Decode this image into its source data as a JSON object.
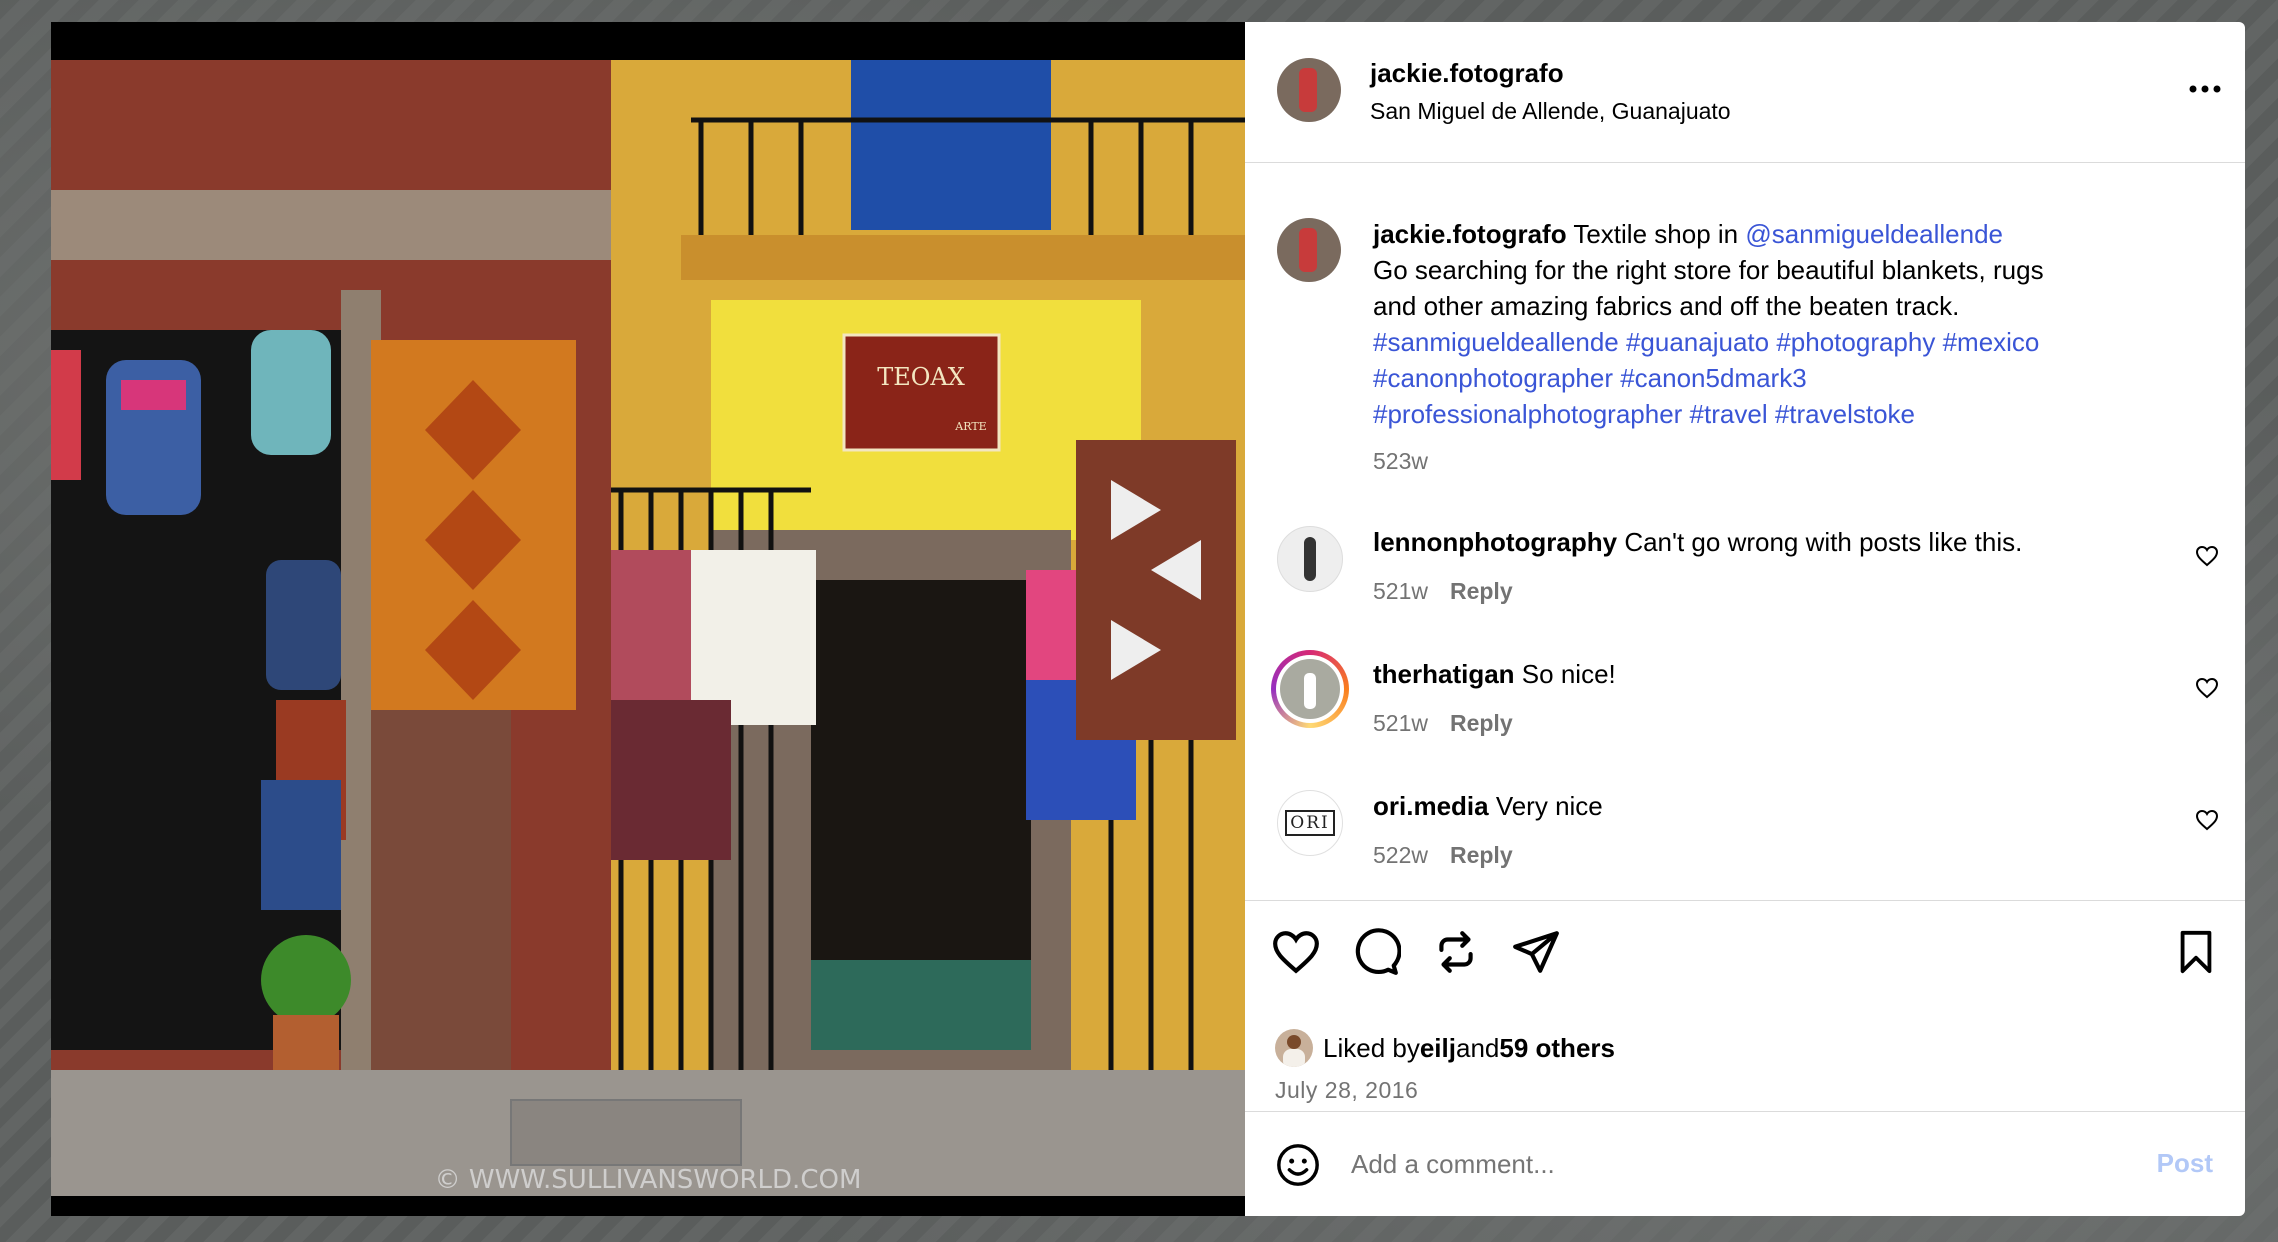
{
  "post": {
    "username": "jackie.fotografo",
    "location": "San Miguel de Allende, Guanajuato",
    "image_watermark": "© WWW.SULLIVANSWORLD.COM",
    "shop_sign": "TEOAX",
    "shop_sign_sub": "ARTE"
  },
  "caption": {
    "username": "jackie.fotografo",
    "text_lead": " Textile shop in ",
    "mention": "@sanmigueldeallende",
    "line2": "Go searching for the right store for beautiful blankets, rugs",
    "line3": "and other amazing fabrics and off the beaten track.",
    "hashtags1": "#sanmigueldeallende #guanajuato #photography #mexico",
    "hashtags2": "#canonphotographer #canon5dmark3",
    "hashtags3": "#professionalphotographer #travel #travelstoke",
    "age": "523w"
  },
  "comments": [
    {
      "username": "lennonphotography",
      "text": " Can't go wrong with posts like this.",
      "age": "521w",
      "reply": "Reply"
    },
    {
      "username": "therhatigan",
      "text": " So nice!",
      "age": "521w",
      "reply": "Reply"
    },
    {
      "username": "ori.media",
      "text": " Very nice",
      "age": "522w",
      "reply": "Reply",
      "avatar_text": "ORI"
    }
  ],
  "likes": {
    "prefix": "Liked by ",
    "user": "eilj",
    "middle": " and ",
    "others": "59 others"
  },
  "date": "July 28, 2016",
  "add_comment": {
    "placeholder": "Add a comment...",
    "post_label": "Post"
  },
  "colors": {
    "link": "#3a55d6",
    "muted": "#737373",
    "post_disabled": "#b2c8f7"
  }
}
